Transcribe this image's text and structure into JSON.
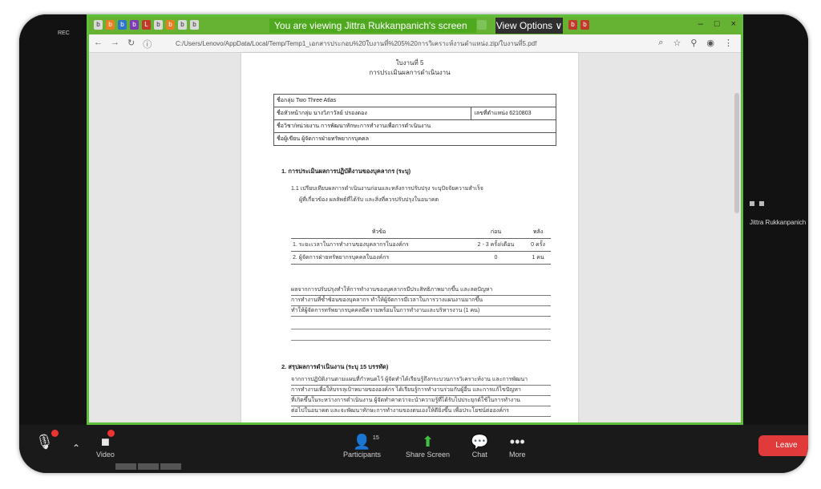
{
  "tabbar": {
    "banner": "You are viewing Jittra Rukkanpanich's screen",
    "view_options": "View Options ∨",
    "tab_letters": [
      "b",
      "b",
      "b",
      "b",
      "L",
      "b",
      "b",
      "b",
      "b"
    ],
    "tab_letters2": [
      "b",
      "b"
    ]
  },
  "window_controls": {
    "minimize": "–",
    "maximize": "□",
    "close": "×"
  },
  "top_left": "REC",
  "address": {
    "url": "C:/Users/Lenovo/AppData/Local/Temp/Temp1_เอกสารประกอบ%20ใบงานที่%205%20การวิเคราะห์งานตำแหน่ง.zip/ใบงานที่5.pdf"
  },
  "pdf": {
    "title": "ใบงานที่ 5",
    "subtitle": "การประเมินผลการดำเนินงาน",
    "info": {
      "row1": "ชื่อกลุ่ม  Two Three Atlas",
      "row2": "ชื่อหัวหน้ากลุ่ม  นางวิภาวัลย์ ปรองดอง",
      "row2_right": "เลขที่ตำแหน่ง  6210803",
      "row3": "ชื่อวิชา/หน่วยงาน  การพัฒนาทักษะการทำงานเพื่อการดำเนินงาน",
      "row4": "ชื่อผู้เขียน  ผู้จัดการฝ่ายทรัพยากรบุคคล"
    },
    "section1": "1.  การประเมินผลการปฏิบัติงานของบุคลากร (ระบุ)",
    "section1_para1": "1.1 เปรียบเทียบผลการดำเนินงานก่อนและหลังการปรับปรุง ระบุปัจจัยความสำเร็จ",
    "section1_para2": "ผู้ที่เกี่ยวข้อง ผลลัพธ์ที่ได้รับ และสิ่งที่ควรปรับปรุงในอนาคต",
    "table": {
      "headers": [
        "หัวข้อ",
        "ก่อน",
        "หลัง"
      ],
      "rows": [
        [
          "1. ระยะเวลาในการทำงานของบุคลากรในองค์กร",
          "2 - 3 ครั้ง/เดือน",
          "0 ครั้ง"
        ],
        [
          "2. ผู้จัดการฝ่ายทรัพยากรบุคคลในองค์กร",
          "0",
          "1 คน"
        ]
      ]
    },
    "summary_lines": [
      "ผลจากการปรับปรุงทำให้การทำงานของบุคลากรมีประสิทธิภาพมากขึ้น และลดปัญหา",
      "การทำงานที่ซ้ำซ้อนของบุคลากร ทำให้ผู้จัดการมีเวลาในการวางแผนงานมากขึ้น",
      "ทำให้ผู้จัดการทรัพยากรบุคคลมีความพร้อมในการทำงานและบริหารงาน (1 คน)"
    ],
    "section2": "2.  สรุปผลการดำเนินงาน (ระบุ 15 บรรทัด)",
    "section2_lines": [
      "จากการปฏิบัติงานตามแผนที่กำหนดไว้ ผู้จัดทำได้เรียนรู้ถึงกระบวนการวิเคราะห์งาน และการพัฒนา",
      "การทำงานเพื่อให้บรรลุเป้าหมายขององค์กร ได้เรียนรู้การทำงานร่วมกับผู้อื่น และการแก้ไขปัญหา",
      "ที่เกิดขึ้นในระหว่างการดำเนินงาน ผู้จัดทำคาดว่าจะนำความรู้ที่ได้รับไปประยุกต์ใช้ในการทำงาน",
      "ต่อไปในอนาคต และจะพัฒนาทักษะการทำงานของตนเองให้ดียิ่งขึ้น เพื่อประโยชน์ต่อองค์กร"
    ]
  },
  "sidebar_user": "Jittra Rukkanpanich",
  "controls": {
    "video": "Video",
    "participants": "Participants",
    "participants_count": "15",
    "share_screen": "Share Screen",
    "chat": "Chat",
    "more": "More",
    "leave": "Leave"
  }
}
